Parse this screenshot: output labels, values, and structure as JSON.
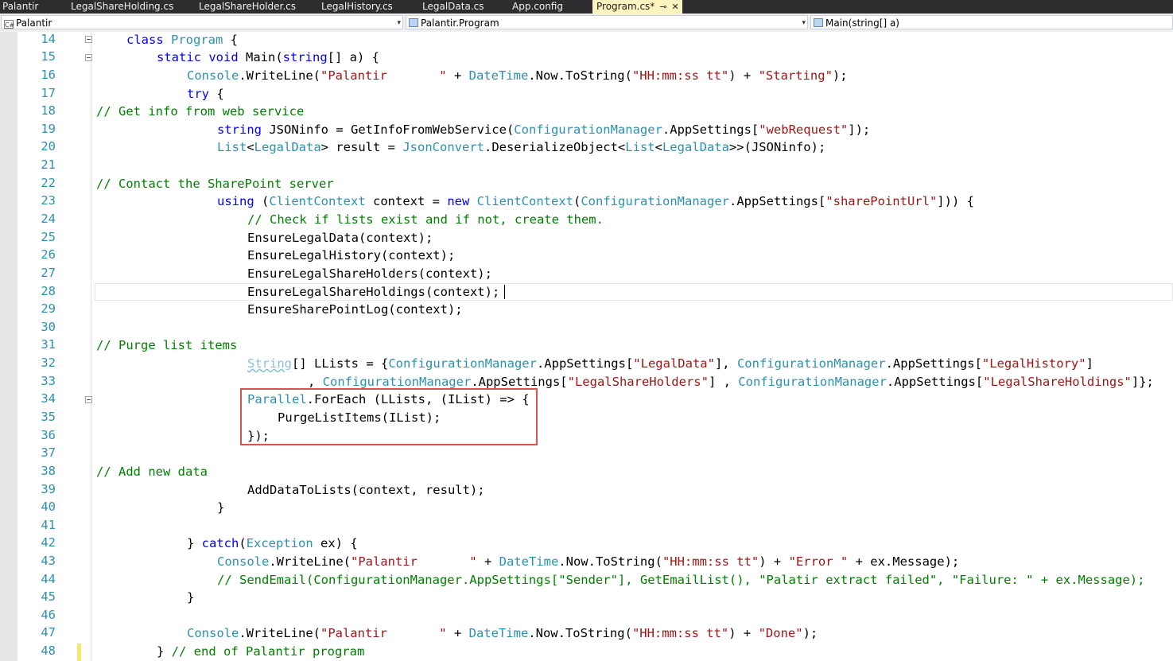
{
  "tabs": [
    "Palantir",
    "LegalShareHolding.cs",
    "LegalShareHolder.cs",
    "LegalHistory.cs",
    "LegalData.cs",
    "App.config",
    "Program.cs*"
  ],
  "nav": {
    "project": "Palantir",
    "class": "Palantir.Program",
    "member": "Main(string[] a)",
    "project_icon_text": "C#"
  },
  "line_numbers": [
    "14",
    "15",
    "16",
    "17",
    "18",
    "19",
    "20",
    "21",
    "22",
    "23",
    "24",
    "25",
    "26",
    "27",
    "28",
    "29",
    "30",
    "31",
    "32",
    "33",
    "34",
    "35",
    "36",
    "37",
    "38",
    "39",
    "40",
    "41",
    "42",
    "43",
    "44",
    "45",
    "46",
    "47",
    "48"
  ],
  "code": {
    "l14": [
      "class ",
      "Program",
      " {"
    ],
    "l15": [
      "static void ",
      "Main",
      "(",
      "string",
      "[] a) {"
    ],
    "l16": [
      "Console",
      ".WriteLine(",
      "\"Palantir       \"",
      " + ",
      "DateTime",
      ".Now.ToString(",
      "\"HH:mm:ss tt\"",
      ") + ",
      "\"Starting\"",
      ");"
    ],
    "l17": [
      "try",
      " {"
    ],
    "l18": "// Get info from web service",
    "l19": [
      "string",
      " JSONinfo = GetInfoFromWebService(",
      "ConfigurationManager",
      ".AppSettings[",
      "\"webRequest\"",
      "]);"
    ],
    "l20": [
      "List",
      "<",
      "LegalData",
      "> result = ",
      "JsonConvert",
      ".DeserializeObject<",
      "List",
      "<",
      "LegalData",
      ">>(JSONinfo);"
    ],
    "l22": "// Contact the SharePoint server",
    "l23": [
      "using",
      " (",
      "ClientContext",
      " context = ",
      "new",
      " ",
      "ClientContext",
      "(",
      "ConfigurationManager",
      ".AppSettings[",
      "\"sharePointUrl\"",
      "])) {"
    ],
    "l24": "// Check if lists exist and if not, create them.",
    "l25": "EnsureLegalData(context);",
    "l26": "EnsureLegalHistory(context);",
    "l27": "EnsureLegalShareHolders(context);",
    "l28": "EnsureLegalShareHoldings(context);",
    "l29": "EnsureSharePointLog(context);",
    "l31": "// Purge list items",
    "l32": [
      "String",
      "[] LLists = {",
      "ConfigurationManager",
      ".AppSettings[",
      "\"LegalData\"",
      "], ",
      "ConfigurationManager",
      ".AppSettings[",
      "\"LegalHistory\"",
      "]"
    ],
    "l33": [
      ", ",
      "ConfigurationManager",
      ".AppSettings[",
      "\"LegalShareHolders\"",
      "] , ",
      "ConfigurationManager",
      ".AppSettings[",
      "\"LegalShareHoldings\"",
      "]};"
    ],
    "l34": [
      "Parallel",
      ".ForEach (LLists, (IList) => {"
    ],
    "l35": "PurgeListItems(IList);",
    "l36": "});",
    "l38": "// Add new data",
    "l39": "AddDataToLists(context, result);",
    "l40": "}",
    "l42": [
      "} ",
      "catch",
      "(",
      "Exception",
      " ex) {"
    ],
    "l43": [
      "Console",
      ".WriteLine(",
      "\"Palantir       \"",
      " + ",
      "DateTime",
      ".Now.ToString(",
      "\"HH:mm:ss tt\"",
      ") + ",
      "\"Error \"",
      " + ex.Message);"
    ],
    "l44": "// SendEmail(ConfigurationManager.AppSettings[\"Sender\"], GetEmailList(), \"Palatir extract failed\", \"Failure: \" + ex.Message);",
    "l45": "}",
    "l47": [
      "Console",
      ".WriteLine(",
      "\"Palantir       \"",
      " + ",
      "DateTime",
      ".Now.ToString(",
      "\"HH:mm:ss tt\"",
      ") + ",
      "\"Done\"",
      ");"
    ],
    "l48": [
      "} ",
      "// end of Palantir program"
    ]
  },
  "colors": {
    "keyword": "#0000ff",
    "type": "#2b91af",
    "string": "#a31515",
    "comment": "#008000",
    "highlight_box": "#d9534f",
    "active_tab": "#fdf4bf"
  }
}
